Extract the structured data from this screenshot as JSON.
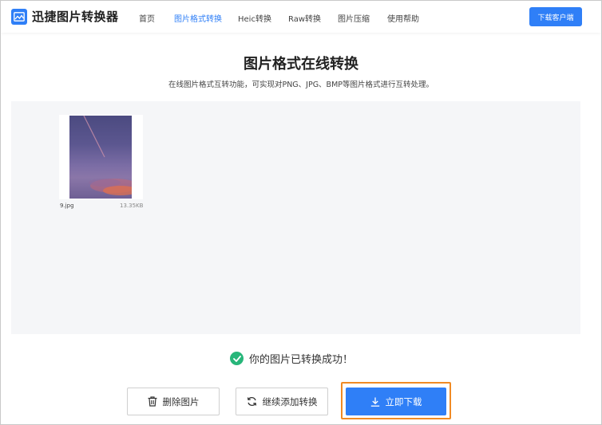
{
  "header": {
    "logo_text": "迅捷图片转换器",
    "nav": [
      {
        "label": "首页"
      },
      {
        "label": "图片格式转换"
      },
      {
        "label": "Heic转换"
      },
      {
        "label": "Raw转换"
      },
      {
        "label": "图片压缩"
      },
      {
        "label": "使用帮助"
      }
    ],
    "active_nav": "图片格式转换",
    "download_client_label": "下载客户端"
  },
  "main": {
    "title": "图片格式在线转换",
    "subtitle": "在线图片格式互转功能，可实现对PNG、JPG、BMP等图片格式进行互转处理。"
  },
  "files": [
    {
      "name": "9.jpg",
      "size": "13.35KB"
    }
  ],
  "status": {
    "message": "你的图片已转换成功！"
  },
  "actions": {
    "delete_label": "删除图片",
    "add_label": "继续添加转换",
    "download_label": "立即下载"
  },
  "colors": {
    "accent": "#2f7ff7",
    "success": "#27b67a",
    "highlight": "#f08a24"
  }
}
